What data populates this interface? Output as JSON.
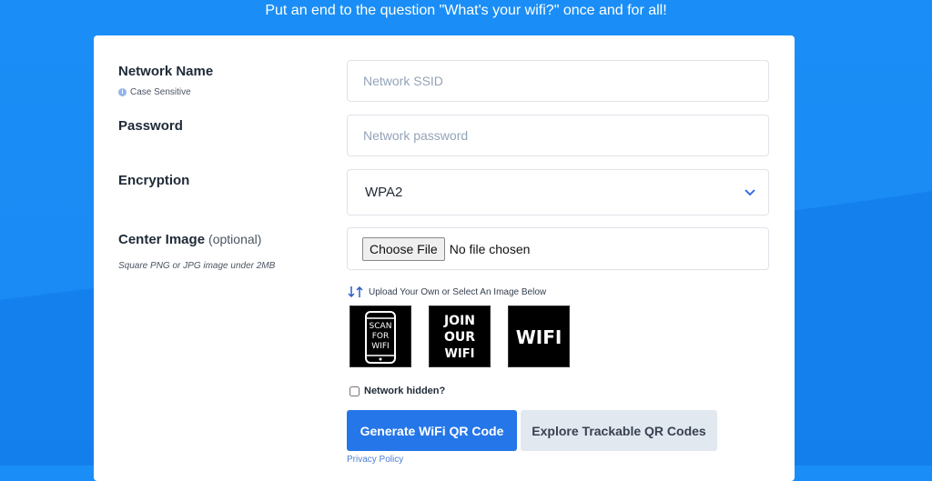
{
  "header": {
    "tagline": "Put an end to the question \"What's your wifi?\" once and for all!"
  },
  "form": {
    "network_name": {
      "label": "Network Name",
      "hint": "Case Sensitive",
      "placeholder": "Network SSID",
      "value": ""
    },
    "password": {
      "label": "Password",
      "placeholder": "Network password",
      "value": ""
    },
    "encryption": {
      "label": "Encryption",
      "selected": "WPA2",
      "icon": "chevron-down-icon"
    },
    "center_image": {
      "label": "Center Image",
      "optional_text": "(optional)",
      "hint": "Square PNG or JPG image under 2MB",
      "choose_button": "Choose File",
      "file_status": "No file chosen",
      "upload_hint": "Upload Your Own or Select An Image Below",
      "presets": [
        {
          "lines": [
            "SCAN",
            "FOR",
            "WIFI"
          ]
        },
        {
          "lines": [
            "JOIN",
            "OUR",
            "WIFI"
          ]
        },
        {
          "lines": [
            "WIFI"
          ]
        }
      ]
    },
    "network_hidden": {
      "label": "Network hidden?",
      "checked": false
    },
    "generate_button": "Generate WiFi QR Code",
    "explore_button": "Explore Trackable QR Codes",
    "privacy_link": "Privacy Policy"
  },
  "colors": {
    "background": "#1a8ef6",
    "primary_button": "#2576e8",
    "secondary_button": "#e2e8f0",
    "link": "#4a7fd6"
  }
}
